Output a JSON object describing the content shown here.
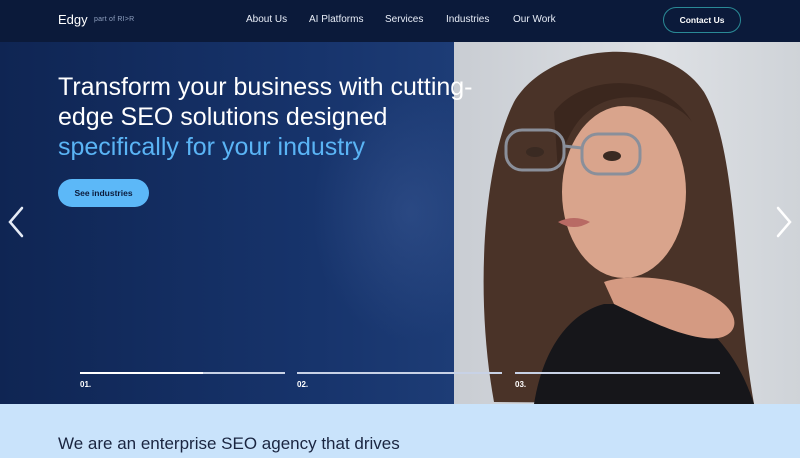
{
  "nav": {
    "brand": "Edgy",
    "brand_sub": "part of RI>R",
    "items": [
      "About Us",
      "AI Platforms",
      "Services",
      "Industries",
      "Our Work"
    ],
    "contact_label": "Contact Us"
  },
  "hero": {
    "headline_line1": "Transform your business with cutting-",
    "headline_line2": "edge SEO solutions designed",
    "headline_accent": "specifically for your industry",
    "cta_label": "See industries",
    "slides": [
      {
        "label": "01.",
        "progress": 0.6
      },
      {
        "label": "02.",
        "progress": 0
      },
      {
        "label": "03.",
        "progress": 0
      }
    ]
  },
  "intro": {
    "text": "We are an enterprise SEO agency that drives"
  },
  "colors": {
    "nav_bg": "#0b1a3a",
    "hero_bg": "#122d60",
    "accent": "#5ab4f5",
    "cta_bg": "#5cb8f8",
    "lower_bg": "#c9e3fb"
  },
  "icons": {
    "prev": "chevron-left-icon",
    "next": "chevron-right-icon"
  }
}
